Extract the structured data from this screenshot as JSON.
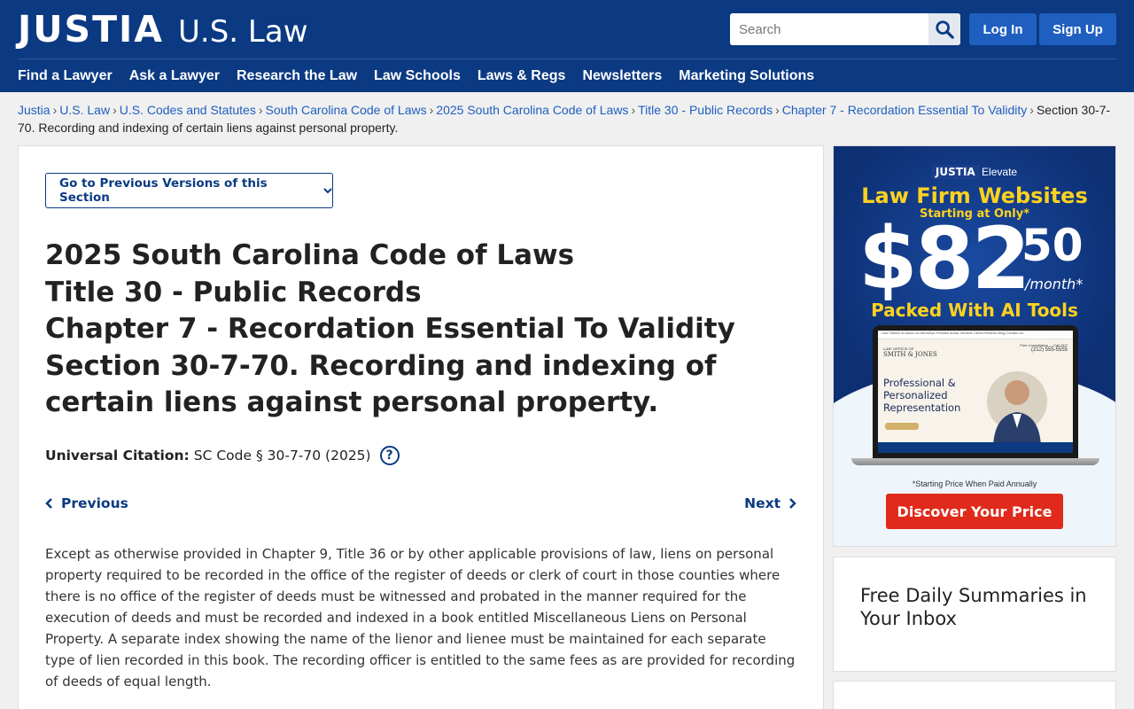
{
  "header": {
    "logo_main": "JUSTIA",
    "logo_sub": "U.S. Law",
    "search_placeholder": "Search",
    "login_label": "Log In",
    "signup_label": "Sign Up",
    "nav": [
      "Find a Lawyer",
      "Ask a Lawyer",
      "Research the Law",
      "Law Schools",
      "Laws & Regs",
      "Newsletters",
      "Marketing Solutions"
    ]
  },
  "breadcrumb": {
    "links": [
      "Justia",
      "U.S. Law",
      "U.S. Codes and Statutes",
      "South Carolina Code of Laws",
      "2025 South Carolina Code of Laws",
      "Title 30 - Public Records",
      "Chapter 7 - Recordation Essential To Validity"
    ],
    "current": "Section 30-7-70. Recording and indexing of certain liens against personal property."
  },
  "main": {
    "versions_label": "Go to Previous Versions of this Section",
    "title_lines": [
      "2025 South Carolina Code of Laws",
      "Title 30 - Public Records",
      "Chapter 7 - Recordation Essential To Validity",
      "Section 30-7-70. Recording and indexing of certain liens against personal property."
    ],
    "citation_label": "Universal Citation:",
    "citation_value": "SC Code § 30-7-70 (2025)",
    "help_symbol": "?",
    "prev_label": "Previous",
    "next_label": "Next",
    "body": "Except as otherwise provided in Chapter 9, Title 36 or by other applicable provisions of law, liens on personal property required to be recorded in the office of the register of deeds or clerk of court in those counties where there is no office of the register of deeds must be witnessed and probated in the manner required for the execution of deeds and must be recorded and indexed in a book entitled Miscellaneous Liens on Personal Property. A separate index showing the name of the lienor and lienee must be maintained for each separate type of lien recorded in this book. The recording officer is entitled to the same fees as are provided for recording of deeds of equal length."
  },
  "ad": {
    "brand": "JUSTIA",
    "brand_sub": "Elevate",
    "title": "Law Firm Websites",
    "starting": "Starting at Only*",
    "price_dollars": "$82",
    "price_cents": "50",
    "per_month": "/month*",
    "packed": "Packed With AI Tools",
    "laptop_nav": "Law Offices of  About Us  Attorneys  Practice Areas  Verdicts  Client Reviews  Blog  Contact Us",
    "laptop_firm_top": "LAW OFFICE OF",
    "laptop_firm": "SMITH & JONES",
    "laptop_phone_top": "Free Consultation — Call 24/7",
    "laptop_phone": "(212) 555-5555",
    "laptop_headline": "Professional & Personalized Representation",
    "note": "*Starting Price When Paid Annually",
    "cta": "Discover Your Price"
  },
  "sidebar": {
    "newsletter_title": "Free Daily Summaries in Your Inbox"
  },
  "colors": {
    "header_bg": "#0b3a82",
    "link": "#1f5fbf",
    "ad_yellow": "#ffd21f",
    "ad_cta": "#e02a1b"
  }
}
